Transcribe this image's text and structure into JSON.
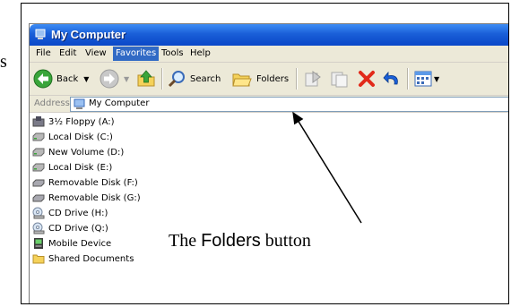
{
  "stray_char": "s",
  "window": {
    "title": "My Computer"
  },
  "menu": [
    "File",
    "Edit",
    "View",
    "Favorites",
    "Tools",
    "Help"
  ],
  "menu_active": "Favorites",
  "toolbar": {
    "back": "Back",
    "search": "Search",
    "folders": "Folders"
  },
  "address": {
    "label": "Address",
    "value": "My Computer"
  },
  "items": [
    {
      "label": "3½ Floppy (A:)",
      "icon": "floppy-icon"
    },
    {
      "label": "Local Disk (C:)",
      "icon": "hard-drive-icon"
    },
    {
      "label": "New Volume (D:)",
      "icon": "hard-drive-icon"
    },
    {
      "label": "Local Disk (E:)",
      "icon": "hard-drive-icon"
    },
    {
      "label": "Removable Disk (F:)",
      "icon": "removable-disk-icon"
    },
    {
      "label": "Removable Disk (G:)",
      "icon": "removable-disk-icon"
    },
    {
      "label": "CD Drive (H:)",
      "icon": "cd-drive-icon"
    },
    {
      "label": "CD Drive (Q:)",
      "icon": "cd-drive-icon"
    },
    {
      "label": "Mobile Device",
      "icon": "mobile-device-icon"
    },
    {
      "label": "Shared Documents",
      "icon": "folder-icon"
    }
  ],
  "annotation": {
    "prefix": "The ",
    "bold": "Folders",
    "suffix": " button"
  },
  "colors": {
    "titlebar": "#0a47c8",
    "menu_highlight": "#316ac5",
    "chrome": "#ece9d8"
  }
}
